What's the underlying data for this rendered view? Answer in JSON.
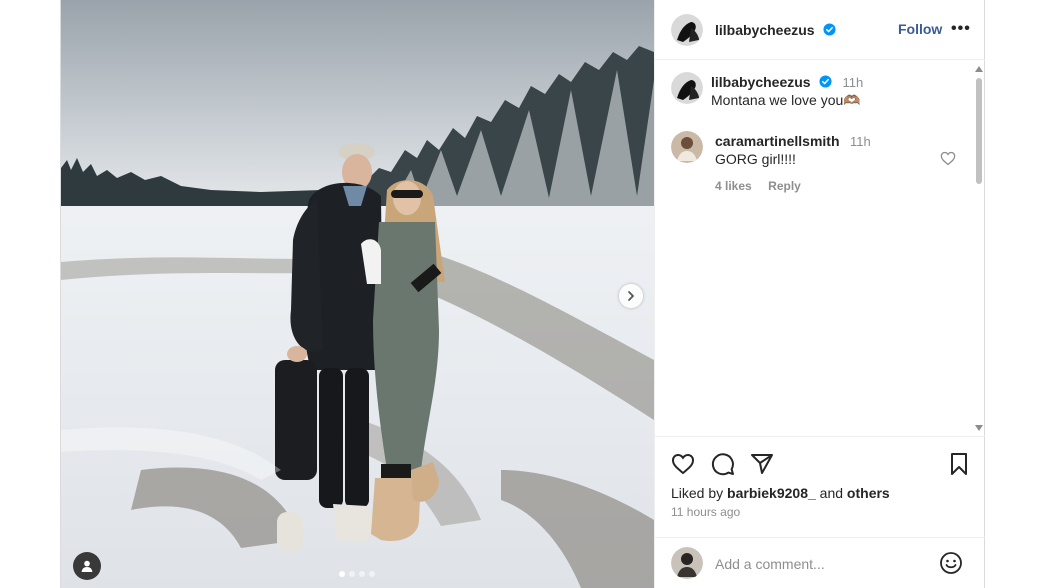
{
  "post": {
    "username": "lilbabycheezus",
    "follow_label": "Follow",
    "more_label": "•••",
    "carousel": {
      "slide_count": 4,
      "active_index": 0
    }
  },
  "caption": {
    "username": "lilbabycheezus",
    "time": "11h",
    "text": "Montana we love you🫶🏽"
  },
  "comments": [
    {
      "username": "caramartinellsmith",
      "time": "11h",
      "text": "GORG girl!!!!",
      "likes": "4 likes",
      "reply_label": "Reply"
    }
  ],
  "likes": {
    "prefix": "Liked by",
    "user": "barbiek9208_",
    "conj": "and",
    "others": "others"
  },
  "timestamp": "11 hours ago",
  "add_comment": {
    "placeholder": "Add a comment..."
  },
  "icons": {
    "verified": "verified-badge-icon",
    "like": "heart-icon",
    "comment": "speech-bubble-icon",
    "share": "paper-plane-icon",
    "save": "bookmark-icon",
    "emoji": "smiley-icon",
    "next": "chevron-right-icon",
    "tag": "person-tag-icon"
  },
  "colors": {
    "follow": "#3c5a9a",
    "verified": "#0095f6",
    "muted": "#8e8e8e"
  }
}
